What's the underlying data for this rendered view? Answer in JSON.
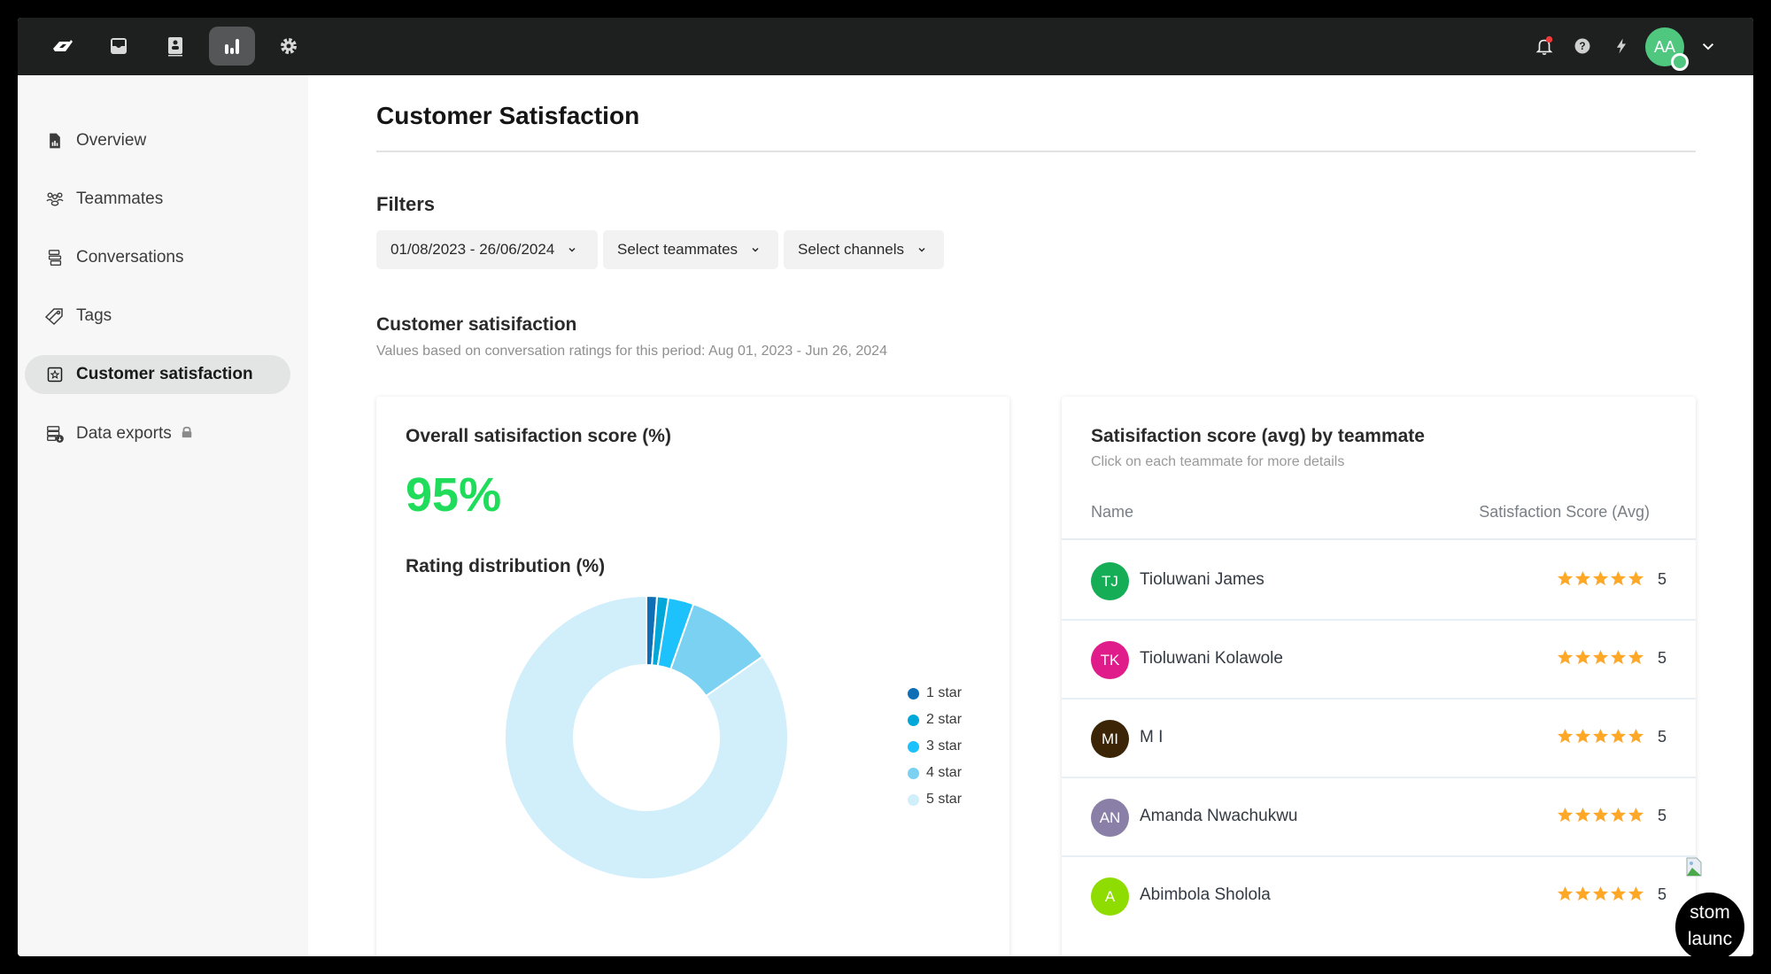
{
  "navbar": {
    "items": [
      {
        "name": "logo",
        "icon": "logo-icon"
      },
      {
        "name": "inbox",
        "icon": "inbox-icon"
      },
      {
        "name": "contacts",
        "icon": "contacts-icon"
      },
      {
        "name": "reports",
        "icon": "bar-chart-icon",
        "active": true
      },
      {
        "name": "settings",
        "icon": "gear-icon"
      }
    ],
    "right": {
      "notification_icon": "bell-icon",
      "help_icon": "question-icon",
      "lightning_icon": "lightning-icon",
      "avatar_initials": "AA",
      "avatar_color": "#4fc77f",
      "dropdown_icon": "chevron-down-icon"
    }
  },
  "sidebar": {
    "items": [
      {
        "label": "Overview",
        "icon": "report-file-icon"
      },
      {
        "label": "Teammates",
        "icon": "team-icon"
      },
      {
        "label": "Conversations",
        "icon": "conversations-icon"
      },
      {
        "label": "Tags",
        "icon": "tags-icon"
      },
      {
        "label": "Customer satisfaction",
        "icon": "star-box-icon",
        "active": true
      },
      {
        "label": "Data exports",
        "icon": "data-export-icon",
        "locked": true
      }
    ]
  },
  "page": {
    "title": "Customer Satisfaction",
    "filters_label": "Filters",
    "filters": [
      {
        "label": "01/08/2023 - 26/06/2024"
      },
      {
        "label": "Select teammates"
      },
      {
        "label": "Select channels"
      }
    ],
    "section_title": "Customer satisifaction",
    "section_subtitle": "Values based on conversation ratings for this period: Aug 01, 2023 - Jun 26, 2024"
  },
  "overall_card": {
    "title": "Overall satisifaction score (%)",
    "score": "95%",
    "score_color": "#1fdc5a",
    "distribution_title": "Rating distribution (%)"
  },
  "chart_data": {
    "type": "pie",
    "title": "Rating distribution (%)",
    "donut": true,
    "categories": [
      "1 star",
      "2 star",
      "3 star",
      "4 star",
      "5 star"
    ],
    "values": [
      1.2,
      1.3,
      2.9,
      9.9,
      84.7
    ],
    "colors": [
      "#0e6fb6",
      "#00a7d9",
      "#1dc1fb",
      "#7ad1f2",
      "#d1eefb"
    ],
    "legend_position": "right"
  },
  "teammates_card": {
    "title": "Satisifaction score (avg) by teammate",
    "subtitle": "Click on each teammate for more details",
    "col_name": "Name",
    "col_score": "Satisfaction Score (Avg)",
    "rows": [
      {
        "initials": "TJ",
        "name": "Tioluwani James",
        "color": "#15ad56",
        "score": "5",
        "stars": 5
      },
      {
        "initials": "TK",
        "name": "Tioluwani Kolawole",
        "color": "#e01c8a",
        "score": "5",
        "stars": 5
      },
      {
        "initials": "MI",
        "name": "M I",
        "color": "#3b2506",
        "score": "5",
        "stars": 5
      },
      {
        "initials": "AN",
        "name": "Amanda Nwachukwu",
        "color": "#8a7fa6",
        "score": "5",
        "stars": 5
      },
      {
        "initials": "A",
        "name": "Abimbola Sholola",
        "color": "#8edc00",
        "score": "5",
        "stars": 5
      }
    ]
  },
  "launcher": {
    "line1": "stom",
    "line2": "launc"
  }
}
